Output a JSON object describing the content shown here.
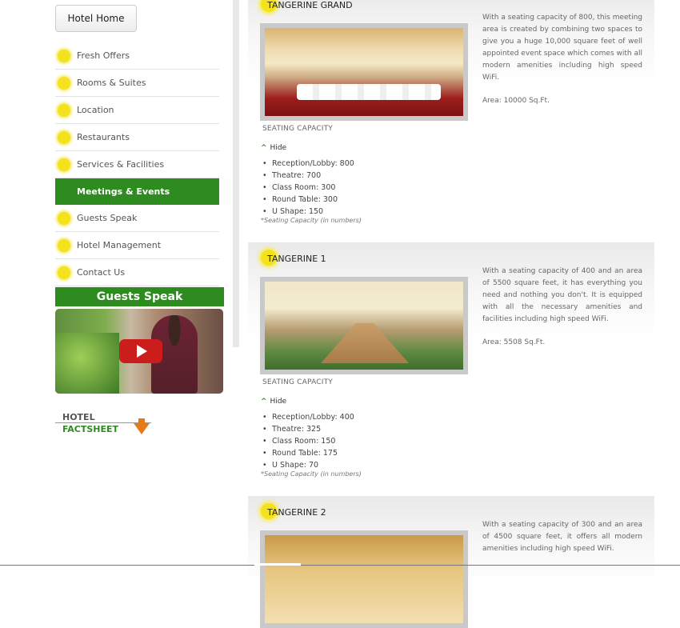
{
  "sidebar": {
    "home_label": "Hotel Home",
    "items": [
      {
        "label": "Fresh Offers"
      },
      {
        "label": "Rooms & Suites"
      },
      {
        "label": "Location"
      },
      {
        "label": "Restaurants"
      },
      {
        "label": "Services & Facilities"
      },
      {
        "label": "Meetings & Events",
        "active": true
      },
      {
        "label": "Guests Speak"
      },
      {
        "label": "Hotel Management"
      },
      {
        "label": "Contact Us"
      }
    ],
    "guests_speak_title": "Guests Speak",
    "factsheet": {
      "line1": "HOTEL",
      "line2": "FACTSHEET"
    }
  },
  "venues": [
    {
      "name": "TANGERINE GRAND",
      "description": "With a seating capacity of 800, this meeting area is created by combining two spaces to give you a huge 10,000 square feet of well appointed event space which comes with all modern amenities including high speed WiFi.",
      "area": "Area: 10000 Sq.Ft.",
      "seating_heading": "SEATING CAPACITY",
      "toggle_label": "Hide",
      "capacities": [
        "Reception/Lobby: 800",
        "Theatre: 700",
        "Class Room: 300",
        "Round Table: 300",
        "U Shape: 150"
      ],
      "note": "*Seating Capacity (in numbers)"
    },
    {
      "name": "TANGERINE 1",
      "description": "With a seating capacity of 400 and an area of 5500 square feet, it has everything you need and nothing you don't. It is equipped with all the necessary amenities and facilities including high speed WiFi.",
      "area": "Area: 5508 Sq.Ft.",
      "seating_heading": "SEATING CAPACITY",
      "toggle_label": "Hide",
      "capacities": [
        "Reception/Lobby: 400",
        "Theatre: 325",
        "Class Room: 150",
        "Round Table: 175",
        "U Shape: 70"
      ],
      "note": "*Seating Capacity (in numbers)"
    },
    {
      "name": "TANGERINE 2",
      "description": "With a seating capacity of 300 and an area of 4500 square feet, it offers all modern amenities including high speed WiFi."
    }
  ]
}
